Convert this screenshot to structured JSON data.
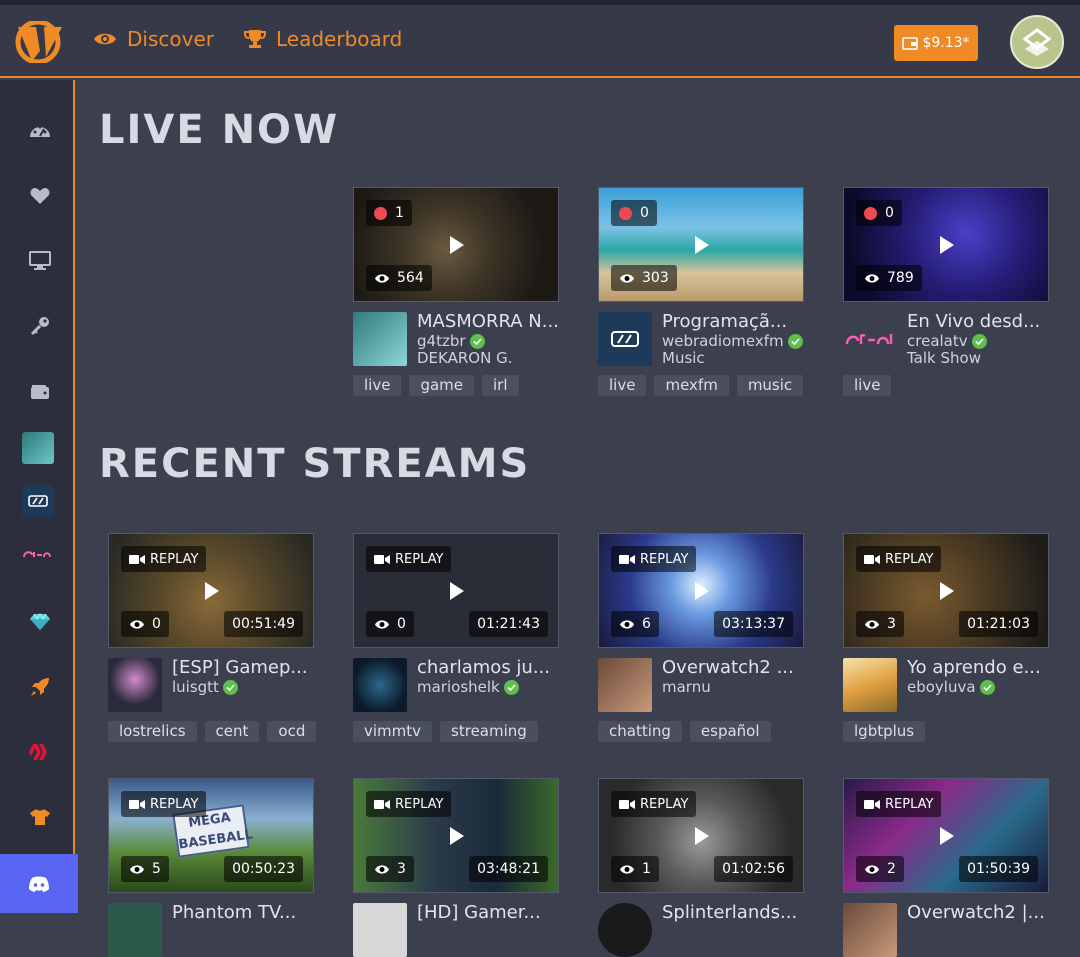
{
  "header": {
    "nav": [
      {
        "label": "Discover"
      },
      {
        "label": "Leaderboard"
      }
    ],
    "wallet": "$9.13*"
  },
  "sections": {
    "live": "LIVE NOW",
    "recent": "RECENT STREAMS"
  },
  "live": [
    {
      "count": "1",
      "views": "564",
      "title": "MASMORRA N...",
      "user": "g4tzbr",
      "category": "DEKARON G.",
      "tags": [
        "live",
        "game",
        "irl"
      ]
    },
    {
      "count": "0",
      "views": "303",
      "title": "Programaçã...",
      "user": "webradiomexfm",
      "category": "Music",
      "tags": [
        "live",
        "mexfm",
        "music"
      ]
    },
    {
      "count": "0",
      "views": "789",
      "title": "En Vivo desd...",
      "user": "crealatv",
      "category": "Talk Show",
      "tags": [
        "live"
      ]
    }
  ],
  "recent": [
    {
      "replay": "REPLAY",
      "views": "0",
      "duration": "00:51:49",
      "title": "[ESP] Gamep...",
      "user": "luisgtt",
      "verified": true,
      "tags": [
        "lostrelics",
        "cent",
        "ocd"
      ]
    },
    {
      "replay": "REPLAY",
      "views": "0",
      "duration": "01:21:43",
      "title": "charlamos ju...",
      "user": "marioshelk",
      "verified": true,
      "tags": [
        "vimmtv",
        "streaming"
      ]
    },
    {
      "replay": "REPLAY",
      "views": "6",
      "duration": "03:13:37",
      "title": "Overwatch2 ...",
      "user": "marnu",
      "verified": false,
      "tags": [
        "chatting",
        "español"
      ]
    },
    {
      "replay": "REPLAY",
      "views": "3",
      "duration": "01:21:03",
      "title": "Yo aprendo e...",
      "user": "eboyluva",
      "verified": true,
      "tags": [
        "lgbtplus"
      ]
    },
    {
      "replay": "REPLAY",
      "views": "5",
      "duration": "00:50:23",
      "title": "Phantom TV...",
      "user": "",
      "verified": false,
      "tags": []
    },
    {
      "replay": "REPLAY",
      "views": "3",
      "duration": "03:48:21",
      "title": "[HD] Gamer...",
      "user": "",
      "verified": false,
      "tags": []
    },
    {
      "replay": "REPLAY",
      "views": "1",
      "duration": "01:02:56",
      "title": "Splinterlands...",
      "user": "",
      "verified": false,
      "tags": []
    },
    {
      "replay": "REPLAY",
      "views": "2",
      "duration": "01:50:39",
      "title": "Overwatch2 |...",
      "user": "",
      "verified": false,
      "tags": []
    }
  ],
  "thumb_labels": {
    "mega_baseball": "MEGA BASEBALL"
  },
  "colors": {
    "accent": "#f08a24",
    "live": "#ef4a52",
    "verified": "#5fbf4e",
    "discord": "#5865f2"
  }
}
